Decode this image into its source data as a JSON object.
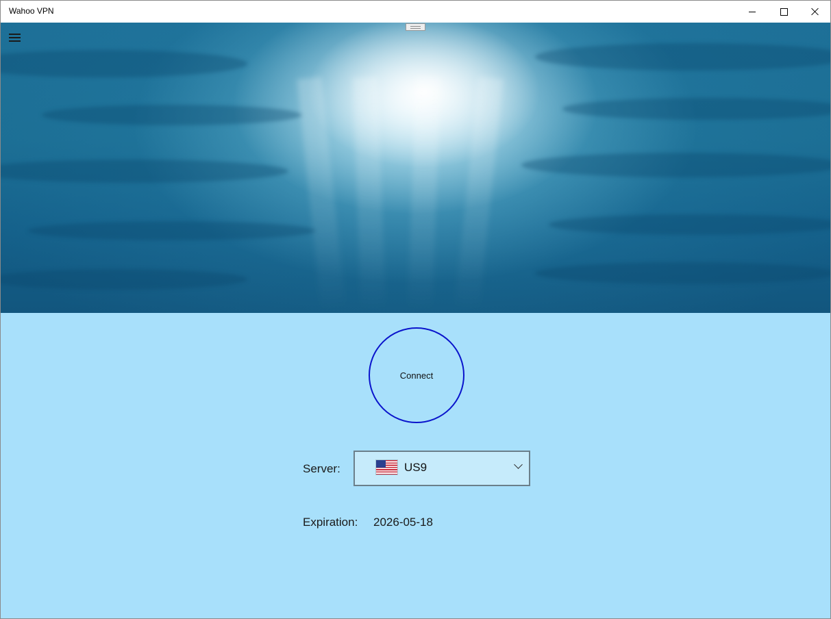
{
  "window": {
    "title": "Wahoo VPN",
    "controls": [
      "minimize",
      "maximize",
      "close"
    ]
  },
  "header": {
    "menu_icon": "hamburger-menu-icon",
    "grip_icon": "resize-grip-icon"
  },
  "main": {
    "connect_label": "Connect",
    "server_label": "Server:",
    "server": {
      "selected": "US9",
      "flag": "us-flag-icon"
    },
    "expiration_label": "Expiration:",
    "expiration_value": "2026-05-18"
  },
  "colors": {
    "content_background": "#a8e0fb",
    "connect_border": "#0a14cc",
    "select_background": "#c6ebfb"
  }
}
